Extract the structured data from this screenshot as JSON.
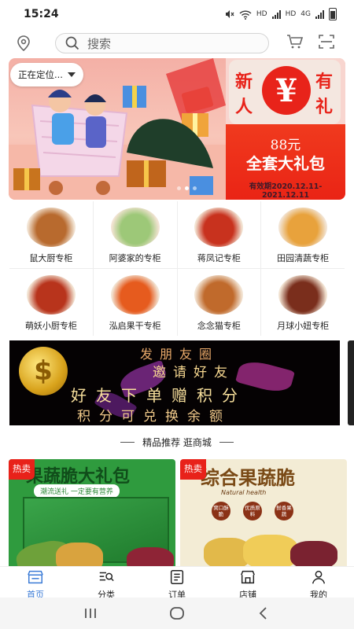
{
  "status_bar": {
    "time": "15:24",
    "net_1": "HD",
    "net_2": "HD",
    "net_sup": "4G"
  },
  "header": {
    "search_placeholder": "搜索"
  },
  "banner": {
    "locate_label": "正在定位...",
    "promo_chars": [
      "新",
      "有",
      "人",
      "礼"
    ],
    "promo_symbol": "¥",
    "promo_amount": "88元",
    "promo_gift": "全套大礼包",
    "promo_dates": "有效期2020.12.11-2021.12.11",
    "slide_count": 3,
    "active_slide": 2
  },
  "categories": [
    {
      "label": "鼠大厨专柜",
      "icon": "nuts-image",
      "color": "#b86a2e"
    },
    {
      "label": "阿婆家的专柜",
      "icon": "mochi-image",
      "color": "#9dc878"
    },
    {
      "label": "蒋凤记专柜",
      "icon": "crayfish-image",
      "color": "#c8321e"
    },
    {
      "label": "田园清蔬专柜",
      "icon": "veggie-chips-image",
      "color": "#e8a23c"
    },
    {
      "label": "萌妖小厨专柜",
      "icon": "sausage-image",
      "color": "#b8341c"
    },
    {
      "label": "泓启果干专柜",
      "icon": "dried-fruit-image",
      "color": "#e65b1e"
    },
    {
      "label": "念念猫专柜",
      "icon": "snack-box-image",
      "color": "#c06a2c"
    },
    {
      "label": "月球小妞专柜",
      "icon": "jerky-image",
      "color": "#7a2e1c"
    }
  ],
  "invite_banner": {
    "line1": "发朋友圈",
    "line2": "邀请好友",
    "line3": "好友下单赠积分",
    "line4": "积分可兑换余额",
    "coin_symbol": "$"
  },
  "section": {
    "title": "精品推荐 逛商城"
  },
  "products": [
    {
      "tag": "热卖",
      "title": "果蔬脆大礼包",
      "subtitle": "潮流送礼 一定要有营养"
    },
    {
      "tag": "热卖",
      "title": "综合果蔬脆",
      "ribbon": "Natural health",
      "badges": [
        "窝口酥脆",
        "优质原料",
        "鲜香果蔬"
      ]
    }
  ],
  "bottom_nav": [
    {
      "label": "首页",
      "icon": "shop-home-icon",
      "active": true
    },
    {
      "label": "分类",
      "icon": "category-search-icon",
      "active": false
    },
    {
      "label": "订单",
      "icon": "order-list-icon",
      "active": false
    },
    {
      "label": "店铺",
      "icon": "store-icon",
      "active": false
    },
    {
      "label": "我的",
      "icon": "user-icon",
      "active": false
    }
  ],
  "colors": {
    "accent": "#3b7bd6",
    "hot": "#e8221a",
    "promo_red": "#e8231a"
  }
}
